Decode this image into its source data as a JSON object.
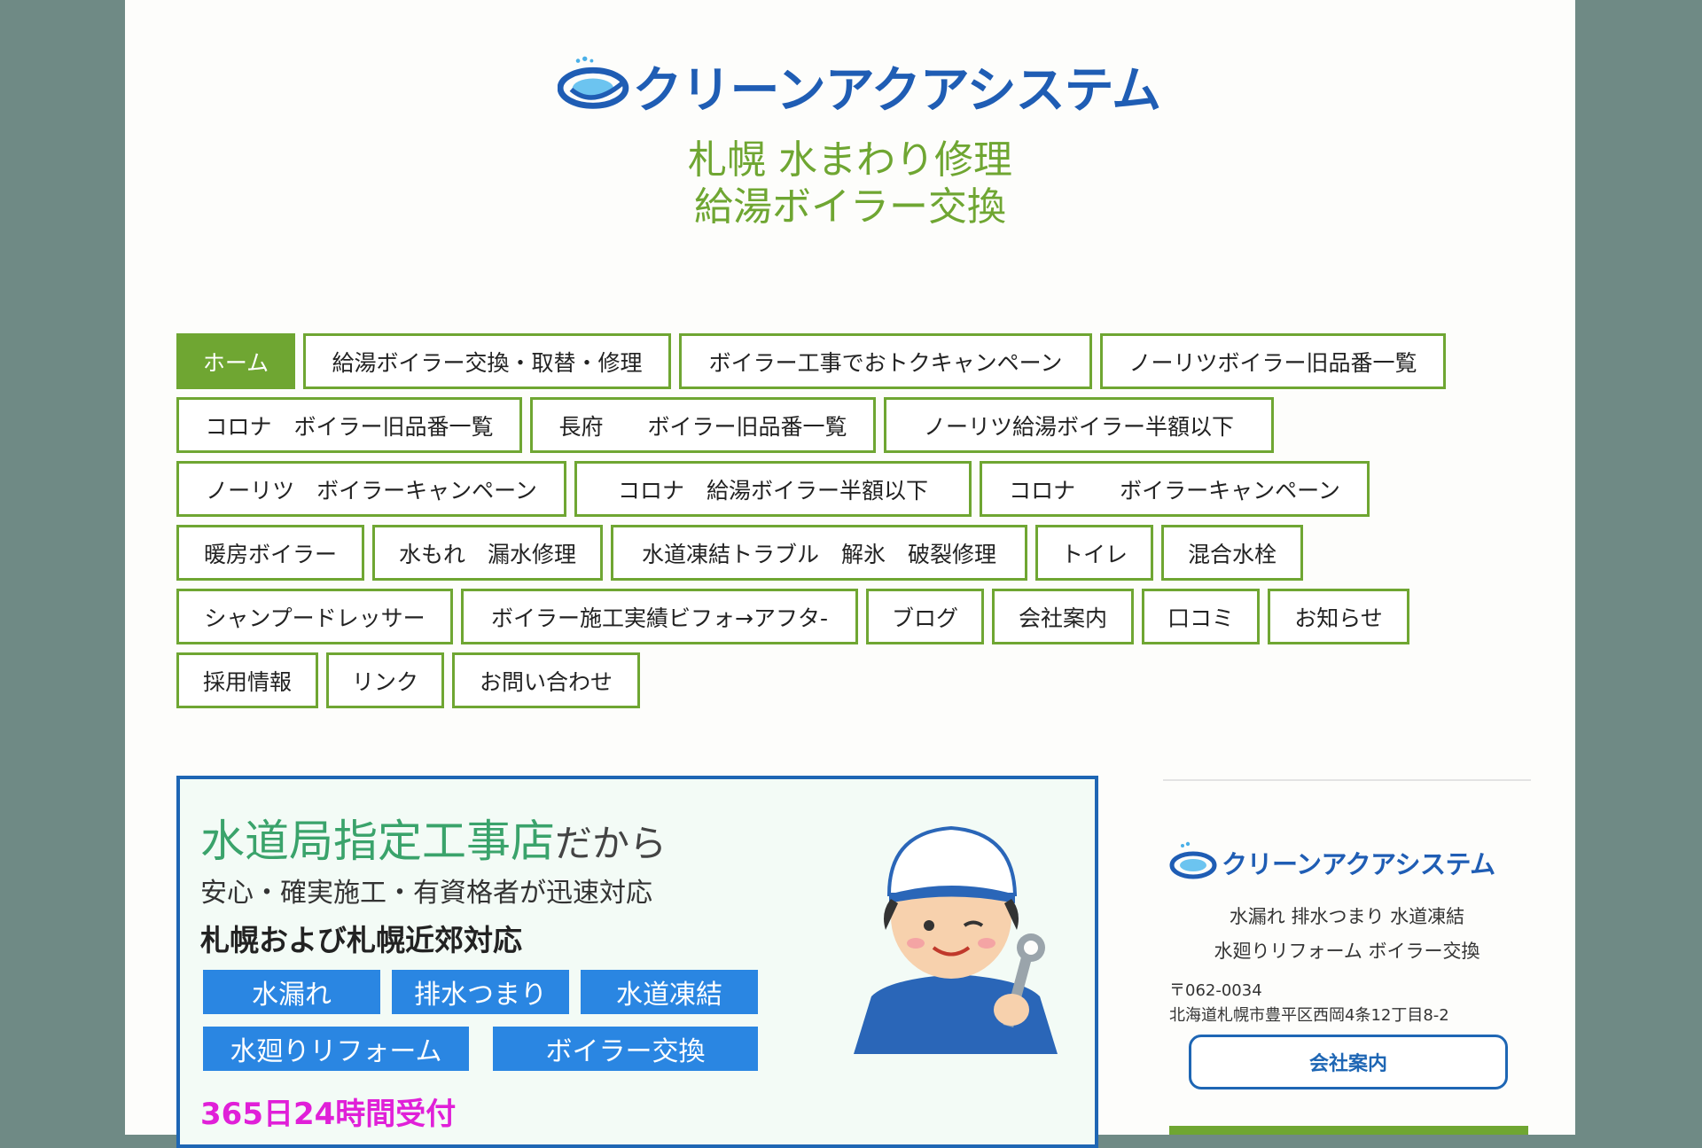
{
  "header": {
    "logo_text": "クリーンアクアシステム",
    "tagline_line1": "札幌 水まわり修理",
    "tagline_line2": "給湯ボイラー交換"
  },
  "nav": {
    "items": [
      {
        "label": "ホーム",
        "active": true
      },
      {
        "label": "給湯ボイラー交換・取替・修理"
      },
      {
        "label": "ボイラー工事でおトクキャンペーン"
      },
      {
        "label": "ノーリツボイラー旧品番一覧"
      },
      {
        "label": "コロナ　ボイラー旧品番一覧"
      },
      {
        "label": "長府　　ボイラー旧品番一覧"
      },
      {
        "label": "ノーリツ給湯ボイラー半額以下"
      },
      {
        "label": "ノーリツ　ボイラーキャンペーン"
      },
      {
        "label": "コロナ　給湯ボイラー半額以下"
      },
      {
        "label": "コロナ　　ボイラーキャンペーン"
      },
      {
        "label": "暖房ボイラー"
      },
      {
        "label": "水もれ　漏水修理"
      },
      {
        "label": "水道凍結トラブル　解氷　破裂修理"
      },
      {
        "label": "トイレ"
      },
      {
        "label": "混合水栓"
      },
      {
        "label": "シャンプードレッサー"
      },
      {
        "label": "ボイラー施工実績ビフォ→アフタ-"
      },
      {
        "label": "ブログ"
      },
      {
        "label": "会社案内"
      },
      {
        "label": "口コミ"
      },
      {
        "label": "お知らせ"
      },
      {
        "label": "採用情報"
      },
      {
        "label": "リンク"
      },
      {
        "label": "お問い合わせ"
      }
    ]
  },
  "banner": {
    "headline_main": "水道局指定工事店",
    "headline_suffix": "だから",
    "subline": "安心・確実施工・有資格者が迅速対応",
    "area": "札幌および札幌近郊対応",
    "services": [
      "水漏れ",
      "排水つまり",
      "水道凍結",
      "水廻りリフォーム",
      "ボイラー交換"
    ],
    "hours": "365日24時間受付"
  },
  "sidebar": {
    "logo_text": "クリーンアクアシステム",
    "services_line1": "水漏れ 排水つまり 水道凍結",
    "services_line2": "水廻りリフォーム ボイラー交換",
    "postal": "〒062-0034",
    "address": "北海道札幌市豊平区西岡4条12丁目8-2",
    "company_button": "会社案内"
  },
  "colors": {
    "background": "#6f8a85",
    "accent_green": "#6fa632",
    "brand_blue": "#1f5db4",
    "service_blue": "#2a86e2",
    "hours_magenta": "#e020d8"
  }
}
